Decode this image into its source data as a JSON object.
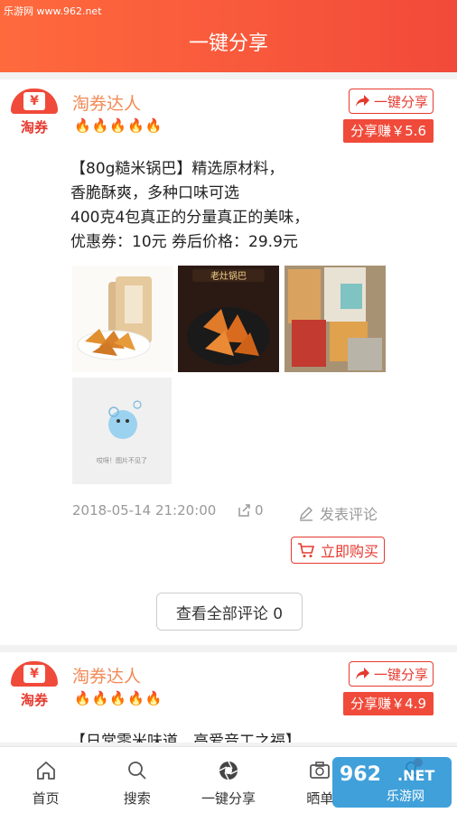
{
  "watermark": "乐游网 www.962.net",
  "header": {
    "title": "一键分享"
  },
  "posts": [
    {
      "logo_text": "淘券",
      "logo_symbol": "¥",
      "author": "淘券达人",
      "flames": "🔥🔥🔥🔥🔥",
      "share_label": "一键分享",
      "earn_label": "分享赚￥5.6",
      "desc_lines": [
        "【80g糙米锅巴】精选原材料，",
        " 香脆酥爽，多种口味可选",
        " 400克4包真正的分量真正的美味，",
        "优惠券：10元   券后价格：29.9元"
      ],
      "images": [
        {
          "icon": "product-photo-rice-crackers-bag"
        },
        {
          "icon": "product-photo-rice-crackers-pan",
          "caption": "老灶锅巴"
        },
        {
          "icon": "product-photo-rice-crackers-packs"
        },
        {
          "icon": "image-not-found-placeholder",
          "caption": "哎呀！图片不见了"
        }
      ],
      "date": "2018-05-14 21:20:00",
      "share_count": "0",
      "comment_label": "发表评论",
      "buy_label": "立即购买",
      "view_all_label": "查看全部评论 0"
    },
    {
      "logo_text": "淘券",
      "logo_symbol": "¥",
      "author": "淘券达人",
      "flames": "🔥🔥🔥🔥🔥",
      "share_label": "一键分享",
      "earn_label": "分享赚￥4.9",
      "desc_first": "【日常零米味道，高爱音工之福】"
    }
  ],
  "nav": [
    {
      "label": "首页",
      "icon": "home-icon"
    },
    {
      "label": "搜索",
      "icon": "search-icon"
    },
    {
      "label": "一键分享",
      "icon": "aperture-icon"
    },
    {
      "label": "晒单",
      "icon": "camera-icon"
    },
    {
      "label": "",
      "icon": "me-icon"
    }
  ],
  "brand_watermark": {
    "text_top": "962",
    "text_net": ".NET",
    "text_bottom": "乐游网"
  },
  "colors": {
    "accent": "#f04a3a",
    "header_start": "#ff6a3d",
    "author": "#f28a56"
  }
}
